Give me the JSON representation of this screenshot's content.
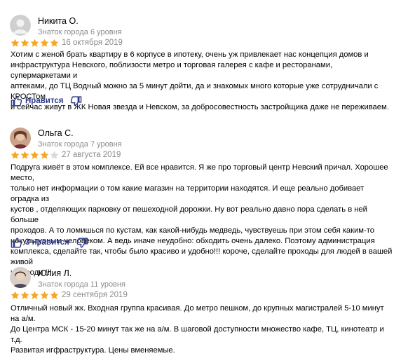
{
  "reviews": [
    {
      "author": "Никита О.",
      "level": "Знаток города 6 уровня",
      "rating": 5,
      "date": "16 октября 2019",
      "text": "Хотим с женой брать квартиру в 6 корпусе в ипотеку, очень уж привлекает нас концепция домов и\nинфраструктура Невского, поблизости метро и торговая галерея с кафе и ресторанами, супермаркетами и\nаптеками, до ТЦ Водный можно за 5 минут дойти, да и знакомых много которые уже сотрудничали с КРОСТом\nи сейчас живут в ЖК Новая звезда и Невском, за добросовестность застройщика даже не переживаем.",
      "like_label": "Нравится"
    },
    {
      "author": "Ольга С.",
      "level": "Знаток города 7 уровня",
      "rating": 4,
      "date": "27 августа 2019",
      "text": "Подруга живёт в этом комплексе. Ей все нравится. Я же про торговый центр Невский причал. Хорошее место,\nтолько нет информации о том какие магазин на территории находятся. И еще реально добивает оградка из\nкустов , отделяющих парковку от пешеходной дорожки. Ну вот реально давно пора сделать в ней больше\nпроходов. А то ломишься по кустам, как какой-нибудь медведь, чувствуешь при этом себя каким-то\nнекультурным человеком. А ведь иначе неудобно: обходить очень далеко. Поэтому администрация\nкомплекса, сделайте так, чтобы было красиво и удобно!!! короче, сделайте проходы для людей в вашей живой\nизгороди !!!",
      "like_label": "3 нравится"
    },
    {
      "author": "Юлия Л.",
      "level": "Знаток города 11 уровня",
      "rating": 5,
      "date": "29 сентября 2019",
      "text": "Отличный новый жк. Входная группа красивая. До метро пешком, до крупных магистралей 5-10 минут на а/м.\nДо Центра МСК - 15-20 минут так же на а/м. В шаговой доступности множество кафе, ТЦ, кинотеатр и т.д.\nРазвитая игфраструктура. Цены вменяемые.",
      "like_label": ""
    }
  ],
  "icons": {
    "avatar_1": "avatar-placeholder-icon",
    "star": "star-icon",
    "like": "thumb-up-icon",
    "dislike": "thumb-down-icon"
  },
  "colors": {
    "star_filled": "#f5a623",
    "star_empty": "#d9d9d9",
    "like_text": "#2f3a8c",
    "meta_text": "#8c8c8c"
  }
}
